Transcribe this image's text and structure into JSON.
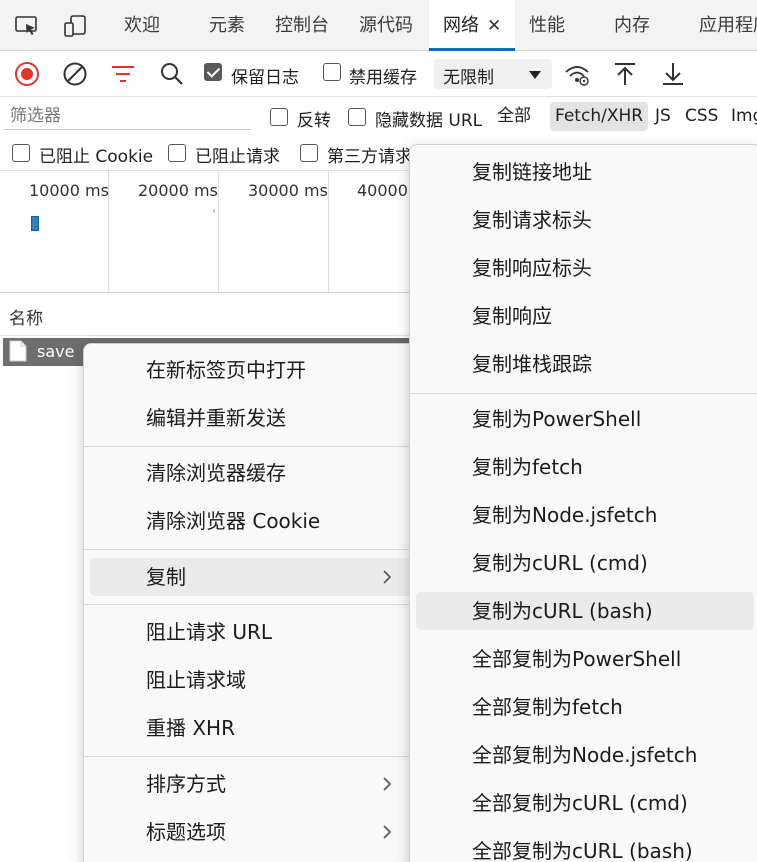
{
  "tabs": {
    "welcome": "欢迎",
    "elements": "元素",
    "console": "控制台",
    "sources": "源代码",
    "network": "网络",
    "network_close": "✕",
    "performance": "性能",
    "memory": "内存",
    "application": "应用程序"
  },
  "toolbar": {
    "preserve_log": "保留日志",
    "disable_cache": "禁用缓存",
    "throttling": "无限制",
    "preserve_log_checked": true,
    "disable_cache_checked": false
  },
  "filter": {
    "placeholder": "筛选器",
    "invert": "反转",
    "hide_data_urls": "隐藏数据 URL",
    "types": [
      "全部",
      "Fetch/XHR",
      "JS",
      "CSS",
      "Img"
    ],
    "active_type": "Fetch/XHR"
  },
  "blocked": {
    "blocked_cookies": "已阻止 Cookie",
    "blocked_requests": "已阻止请求",
    "third_party": "第三方请求"
  },
  "overview": {
    "ticks": [
      "10000 ms",
      "20000 ms",
      "30000 ms",
      "40000"
    ]
  },
  "request_list": {
    "column_name": "名称",
    "rows": [
      "save"
    ]
  },
  "context_menu": {
    "items": [
      "在新标签页中打开",
      "编辑并重新发送",
      "清除浏览器缓存",
      "清除浏览器 Cookie",
      "复制",
      "阻止请求 URL",
      "阻止请求域",
      "重播 XHR",
      "排序方式",
      "标题选项"
    ],
    "highlighted": "复制"
  },
  "copy_submenu": {
    "items": [
      "复制链接地址",
      "复制请求标头",
      "复制响应标头",
      "复制响应",
      "复制堆栈跟踪",
      "复制为PowerShell",
      "复制为fetch",
      "复制为Node.jsfetch",
      "复制为cURL (cmd)",
      "复制为cURL (bash)",
      "全部复制为PowerShell",
      "全部复制为fetch",
      "全部复制为Node.jsfetch",
      "全部复制为cURL (cmd)",
      "全部复制为cURL (bash)"
    ],
    "highlighted": "复制为cURL (bash)"
  },
  "colors": {
    "record_red": "#e5332a",
    "filter_red": "#e5332a",
    "accent_blue": "#0f6cbd",
    "selected_row": "#6e6e6e"
  },
  "icons": [
    "inspect-icon",
    "device-icon",
    "record-icon",
    "clear-icon",
    "filter-icon",
    "search-icon",
    "online-icon",
    "import-icon",
    "export-icon",
    "document-icon",
    "chevron-right-icon",
    "dropdown-caret-icon"
  ]
}
